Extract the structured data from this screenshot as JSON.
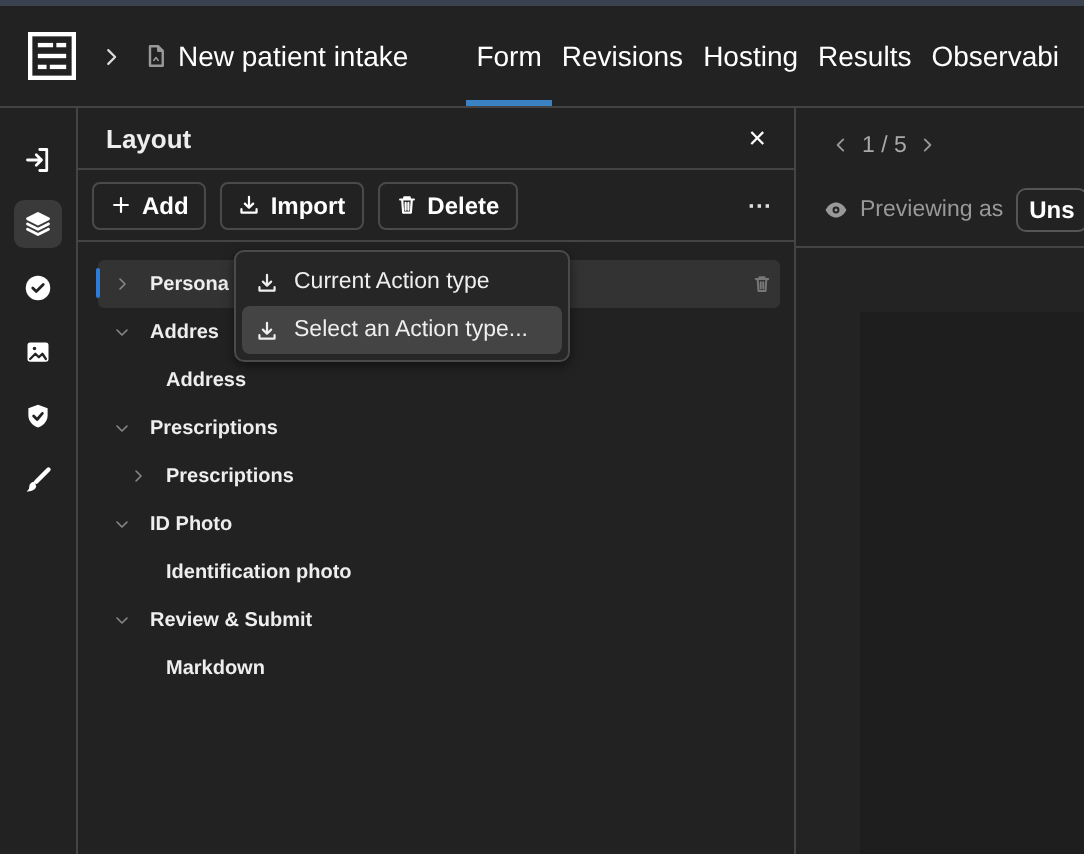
{
  "header": {
    "title": "New patient intake",
    "tabs": [
      {
        "label": "Form",
        "selected": true
      },
      {
        "label": "Revisions",
        "selected": false
      },
      {
        "label": "Hosting",
        "selected": false
      },
      {
        "label": "Results",
        "selected": false
      },
      {
        "label": "Observabi",
        "selected": false
      }
    ]
  },
  "rail": [
    {
      "kind": "enter",
      "selected": false
    },
    {
      "kind": "layers",
      "selected": true
    },
    {
      "kind": "check",
      "selected": false
    },
    {
      "kind": "image",
      "selected": false
    },
    {
      "kind": "shield",
      "selected": false
    },
    {
      "kind": "brush",
      "selected": false
    }
  ],
  "panel": {
    "title": "Layout",
    "close": "×",
    "buttons": [
      {
        "kind": "add",
        "label": "Add"
      },
      {
        "kind": "import",
        "label": "Import"
      },
      {
        "kind": "delete",
        "label": "Delete"
      }
    ],
    "more": "···",
    "tree": [
      {
        "label": "Persona",
        "expanded": false,
        "selected": true
      },
      {
        "label": "Addres",
        "expanded": true,
        "selected": false,
        "children": [
          {
            "label": "Address",
            "selected": false
          }
        ]
      },
      {
        "label": "Prescriptions",
        "expanded": true,
        "selected": false,
        "children": [
          {
            "label": "Prescriptions",
            "expanded": false,
            "selected": false
          }
        ]
      },
      {
        "label": "ID Photo",
        "expanded": true,
        "selected": false,
        "children": [
          {
            "label": "Identification photo",
            "selected": false
          }
        ]
      },
      {
        "label": "Review & Submit",
        "expanded": true,
        "selected": false,
        "children": [
          {
            "label": "Markdown",
            "selected": false
          }
        ]
      }
    ],
    "menu": [
      {
        "label": "Current Action type",
        "selected": false
      },
      {
        "label": "Select an Action type...",
        "selected": true
      }
    ]
  },
  "preview": {
    "page": "1 / 5",
    "previewing_label": "Previewing as",
    "previewing_value": "Uns"
  }
}
